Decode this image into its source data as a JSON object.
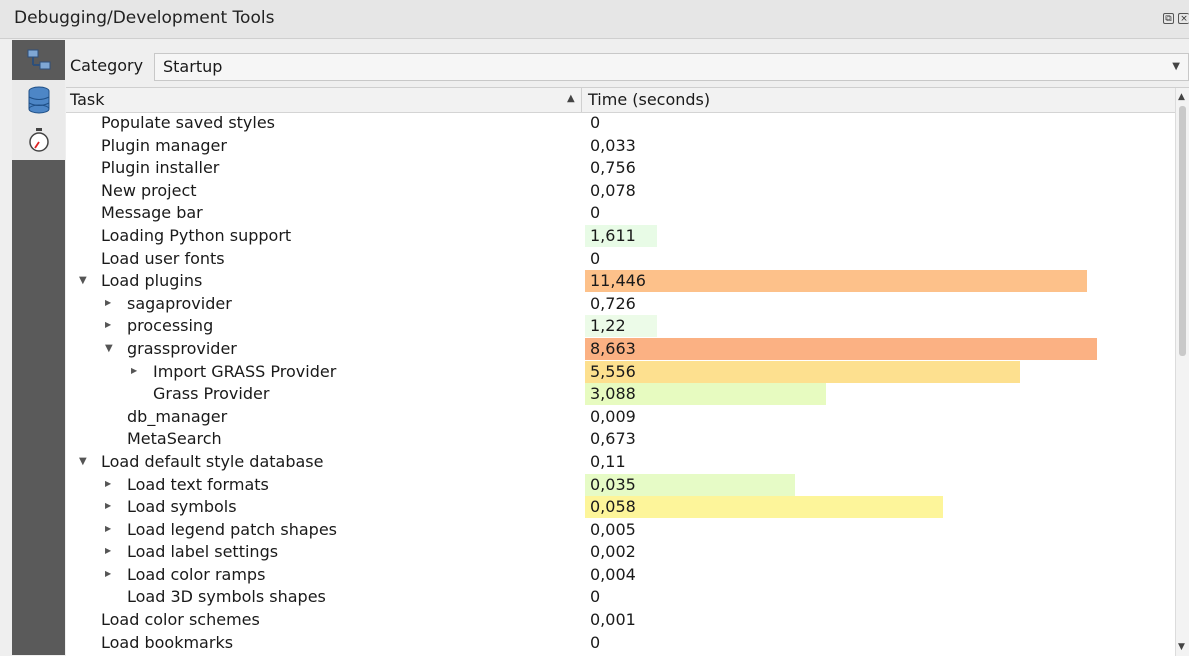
{
  "window": {
    "title": "Debugging/Development Tools",
    "buttons": [
      "restore-icon",
      "close-icon"
    ]
  },
  "sidebar": {
    "items": [
      {
        "icon": "network-icon"
      },
      {
        "icon": "database-icon"
      },
      {
        "icon": "stopwatch-icon"
      }
    ]
  },
  "category": {
    "label": "Category",
    "value": "Startup"
  },
  "table": {
    "columns": [
      "Task",
      "Time (seconds)"
    ],
    "rows": [
      {
        "task": "Populate saved styles",
        "time": "0",
        "level": 0,
        "expander": "none"
      },
      {
        "task": "Plugin manager",
        "time": "0,033",
        "level": 0,
        "expander": "none"
      },
      {
        "task": "Plugin installer",
        "time": "0,756",
        "level": 0,
        "expander": "none"
      },
      {
        "task": "New project",
        "time": "0,078",
        "level": 0,
        "expander": "none"
      },
      {
        "task": "Message bar",
        "time": "0",
        "level": 0,
        "expander": "none"
      },
      {
        "task": "Loading Python support",
        "time": "1,611",
        "level": 0,
        "expander": "none",
        "bar": 0.14,
        "color": "#e8fbe6"
      },
      {
        "task": "Load user fonts",
        "time": "0",
        "level": 0,
        "expander": "none"
      },
      {
        "task": "Load plugins",
        "time": "11,446",
        "level": 0,
        "expander": "expanded",
        "bar": 0.98,
        "color": "#fdc18a"
      },
      {
        "task": "sagaprovider",
        "time": "0,726",
        "level": 1,
        "expander": "collapsed"
      },
      {
        "task": "processing",
        "time": "1,22",
        "level": 1,
        "expander": "collapsed",
        "bar": 0.14,
        "color": "#ecfbe8"
      },
      {
        "task": "grassprovider",
        "time": "8,663",
        "level": 1,
        "expander": "expanded",
        "bar": 1.0,
        "color": "#fbb183"
      },
      {
        "task": "Import GRASS Provider",
        "time": "5,556",
        "level": 2,
        "expander": "collapsed",
        "bar": 0.85,
        "color": "#fde08f"
      },
      {
        "task": "Grass Provider",
        "time": "3,088",
        "level": 2,
        "expander": "none",
        "bar": 0.47,
        "color": "#e7fbc0"
      },
      {
        "task": "db_manager",
        "time": "0,009",
        "level": 1,
        "expander": "none"
      },
      {
        "task": "MetaSearch",
        "time": "0,673",
        "level": 1,
        "expander": "none"
      },
      {
        "task": "Load default style database",
        "time": "0,11",
        "level": 0,
        "expander": "expanded"
      },
      {
        "task": "Load text formats",
        "time": "0,035",
        "level": 1,
        "expander": "collapsed",
        "bar": 0.41,
        "color": "#e6fbc6"
      },
      {
        "task": "Load symbols",
        "time": "0,058",
        "level": 1,
        "expander": "collapsed",
        "bar": 0.7,
        "color": "#fdf59a"
      },
      {
        "task": "Load legend patch shapes",
        "time": "0,005",
        "level": 1,
        "expander": "collapsed"
      },
      {
        "task": "Load label settings",
        "time": "0,002",
        "level": 1,
        "expander": "collapsed"
      },
      {
        "task": "Load color ramps",
        "time": "0,004",
        "level": 1,
        "expander": "collapsed"
      },
      {
        "task": "Load 3D symbols shapes",
        "time": "0",
        "level": 1,
        "expander": "none"
      },
      {
        "task": "Load color schemes",
        "time": "0,001",
        "level": 0,
        "expander": "none"
      },
      {
        "task": "Load bookmarks",
        "time": "0",
        "level": 0,
        "expander": "none"
      }
    ]
  }
}
